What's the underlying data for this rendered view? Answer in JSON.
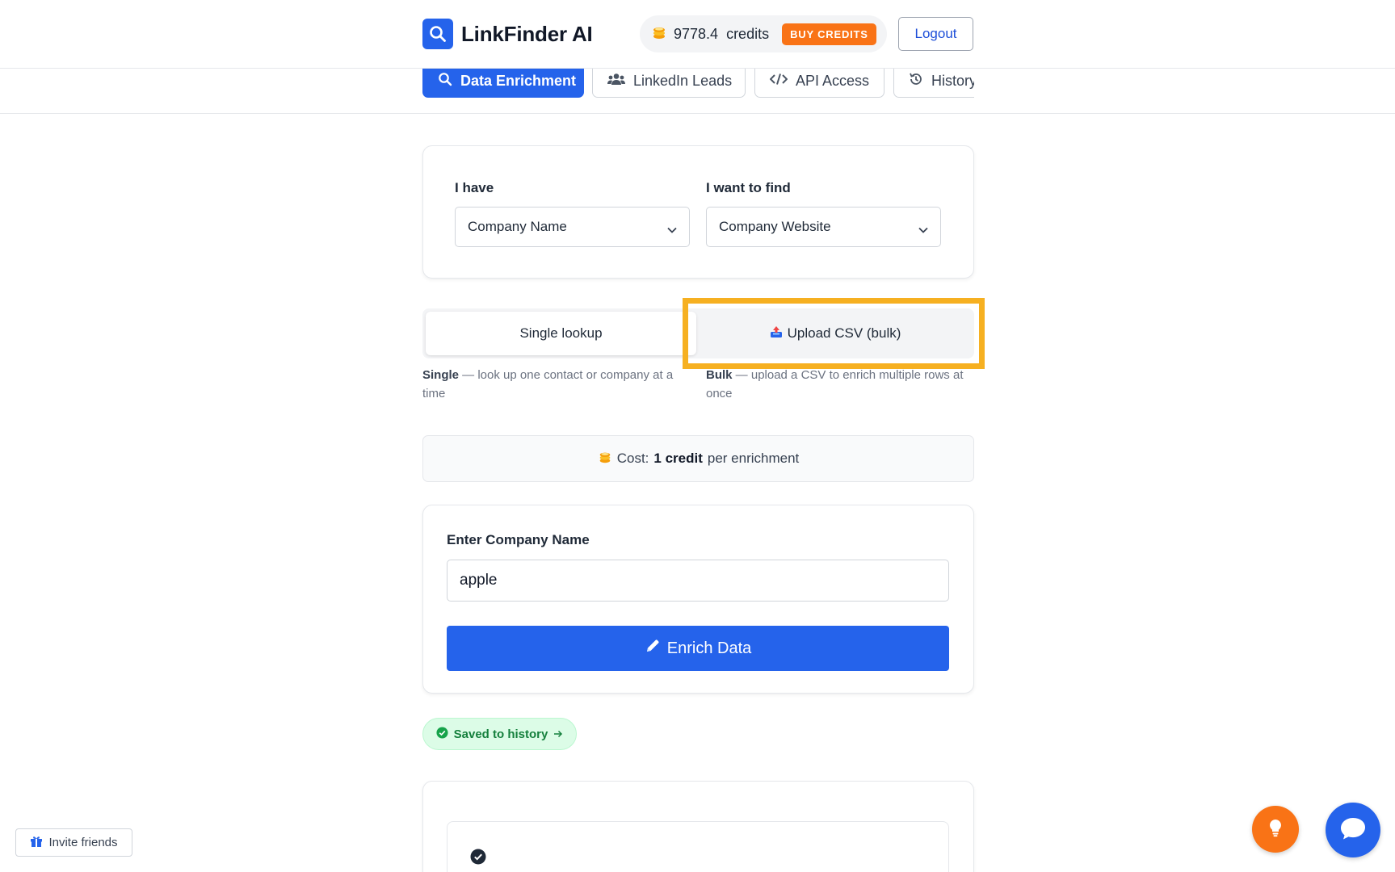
{
  "header": {
    "app_name": "LinkFinder AI",
    "credits_amount": "9778.4",
    "credits_word": "credits",
    "buy_label": "BUY CREDITS",
    "logout_label": "Logout"
  },
  "tabs": [
    {
      "label": "Data Enrichment",
      "icon": "search-icon",
      "active": true
    },
    {
      "label": "LinkedIn Leads",
      "icon": "users-icon",
      "active": false
    },
    {
      "label": "API Access",
      "icon": "code-icon",
      "active": false
    },
    {
      "label": "History",
      "icon": "history-icon",
      "active": false
    }
  ],
  "selector_card": {
    "have_label": "I have",
    "have_value": "Company Name",
    "find_label": "I want to find",
    "find_value": "Company Website"
  },
  "mode": {
    "single_label": "Single lookup",
    "bulk_label": "Upload CSV (bulk)",
    "selected": "single",
    "single_desc_bold": "Single",
    "single_desc": " — look up one contact or company at a time",
    "bulk_desc_bold": "Bulk",
    "bulk_desc": " — upload a CSV to enrich multiple rows at once"
  },
  "cost": {
    "prefix": "Cost:",
    "amount": "1 credit",
    "suffix": "per enrichment"
  },
  "input_card": {
    "label": "Enter Company Name",
    "value": "apple",
    "button_label": "Enrich Data"
  },
  "saved_label": "Saved to history",
  "invite_label": "Invite friends",
  "colors": {
    "primary": "#2563eb",
    "accent": "#f97316",
    "success": "#15803d",
    "highlight": "#f6b021"
  }
}
